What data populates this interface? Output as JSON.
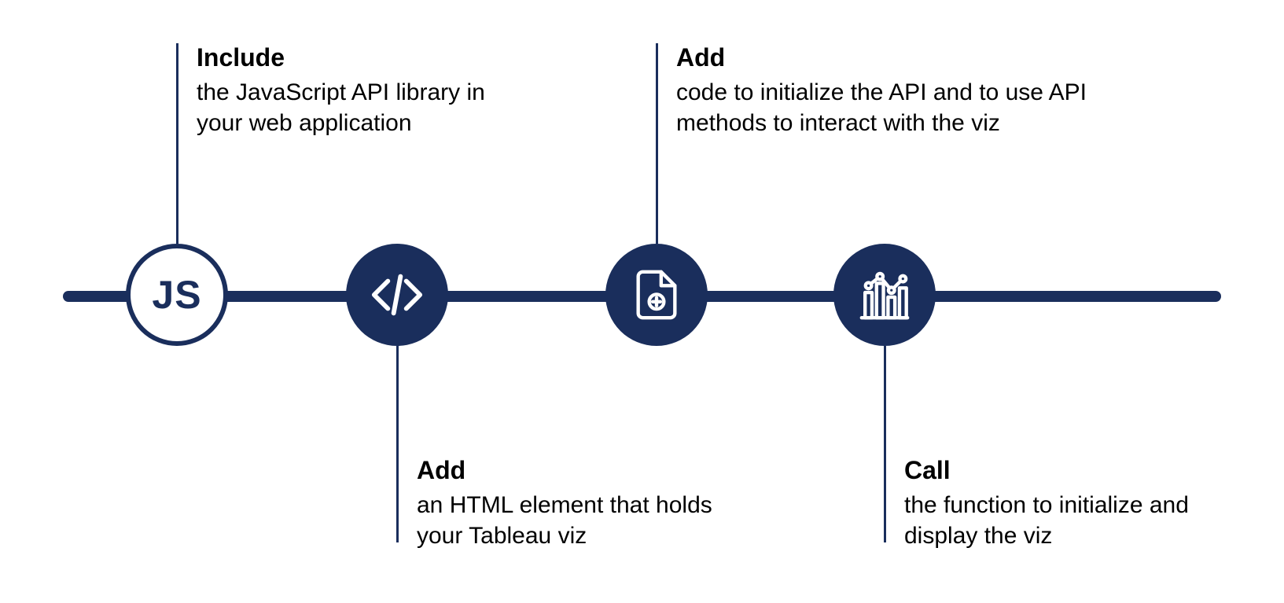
{
  "colors": {
    "primary": "#1a2e5c",
    "background": "#ffffff",
    "text": "#000000",
    "iconStroke": "#ffffff"
  },
  "steps": [
    {
      "icon": "js-text",
      "title": "Include",
      "body": "the JavaScript API library in your web application",
      "position": "top"
    },
    {
      "icon": "code-brackets",
      "title": "Add",
      "body": "an HTML element that holds your Tableau viz",
      "position": "bottom"
    },
    {
      "icon": "file-add",
      "title": "Add",
      "body": "code to initialize the API and to use API methods to interact with the viz",
      "position": "top"
    },
    {
      "icon": "bar-chart",
      "title": "Call",
      "body": "the function to initialize and display the viz",
      "position": "bottom"
    }
  ]
}
